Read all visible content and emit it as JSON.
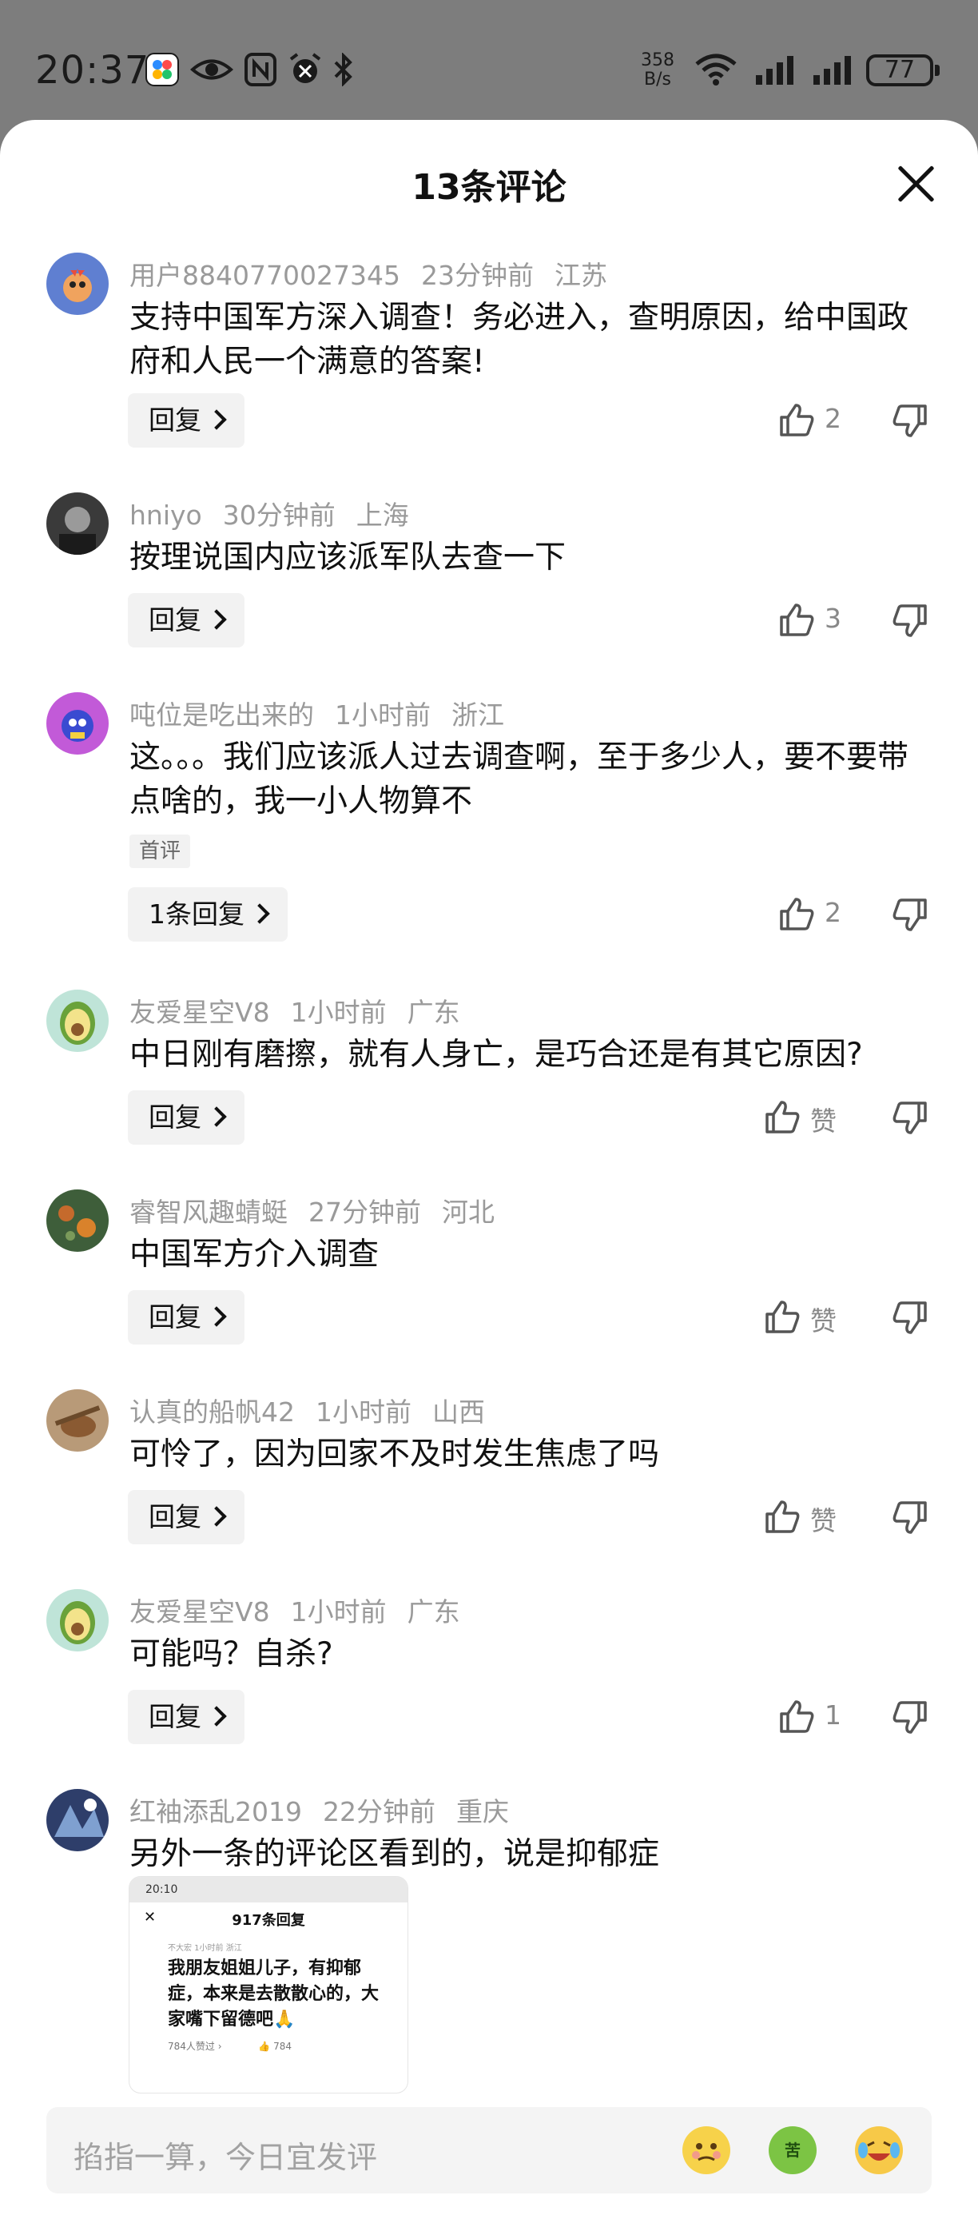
{
  "status_bar": {
    "time": "20:37",
    "net_speed_value": "358",
    "net_speed_unit": "B/s",
    "battery": "77"
  },
  "sheet": {
    "title": "13条评论"
  },
  "comments": [
    {
      "user": "用户8840770027345",
      "time": "23分钟前",
      "location": "江苏",
      "text": "支持中国军方深入调查！务必进入，查明原因，给中国政府和人民一个满意的答案!",
      "reply_label": "回复",
      "likes": "2"
    },
    {
      "user": "hniyo",
      "time": "30分钟前",
      "location": "上海",
      "text": "按理说国内应该派军队去查一下",
      "reply_label": "回复",
      "likes": "3"
    },
    {
      "user": "吨位是吃出来的",
      "time": "1小时前",
      "location": "浙江",
      "text": "这。。。我们应该派人过去调查啊，至于多少人，要不要带点啥的，我一小人物算不",
      "badge": "首评",
      "reply_label": "1条回复",
      "likes": "2"
    },
    {
      "user": "友爱星空V8",
      "time": "1小时前",
      "location": "广东",
      "text": "中日刚有磨擦，就有人身亡，是巧合还是有其它原因?",
      "reply_label": "回复",
      "likes": "赞"
    },
    {
      "user": "睿智风趣蜻蜓",
      "time": "27分钟前",
      "location": "河北",
      "text": "中国军方介入调查",
      "reply_label": "回复",
      "likes": "赞"
    },
    {
      "user": "认真的船帆42",
      "time": "1小时前",
      "location": "山西",
      "text": "可怜了，因为回家不及时发生焦虑了吗",
      "reply_label": "回复",
      "likes": "赞"
    },
    {
      "user": "友爱星空V8",
      "time": "1小时前",
      "location": "广东",
      "text": "可能吗？自杀?",
      "reply_label": "回复",
      "likes": "1"
    },
    {
      "user": "红袖添乱2019",
      "time": "22分钟前",
      "location": "重庆",
      "text": "另外一条的评论区看到的，说是抑郁症"
    }
  ],
  "embedded_screenshot": {
    "status_time": "20:10",
    "title": "917条回复",
    "user_line": "不大宏 1小时前 浙江",
    "text": "我朋友姐姐儿子，有抑郁症，本来是去散散心的，大家嘴下留德吧🙏",
    "footer": "784人赞过 ›",
    "likes": "784"
  },
  "input": {
    "placeholder": "掐指一算，今日宜发评"
  },
  "emojis": [
    {
      "name": "thinking-emoji",
      "color": "#f7d24a"
    },
    {
      "name": "bitter-emoji",
      "label": "苦",
      "color": "#7cc444"
    },
    {
      "name": "laughing-crying-emoji",
      "color": "#f7c948"
    }
  ]
}
